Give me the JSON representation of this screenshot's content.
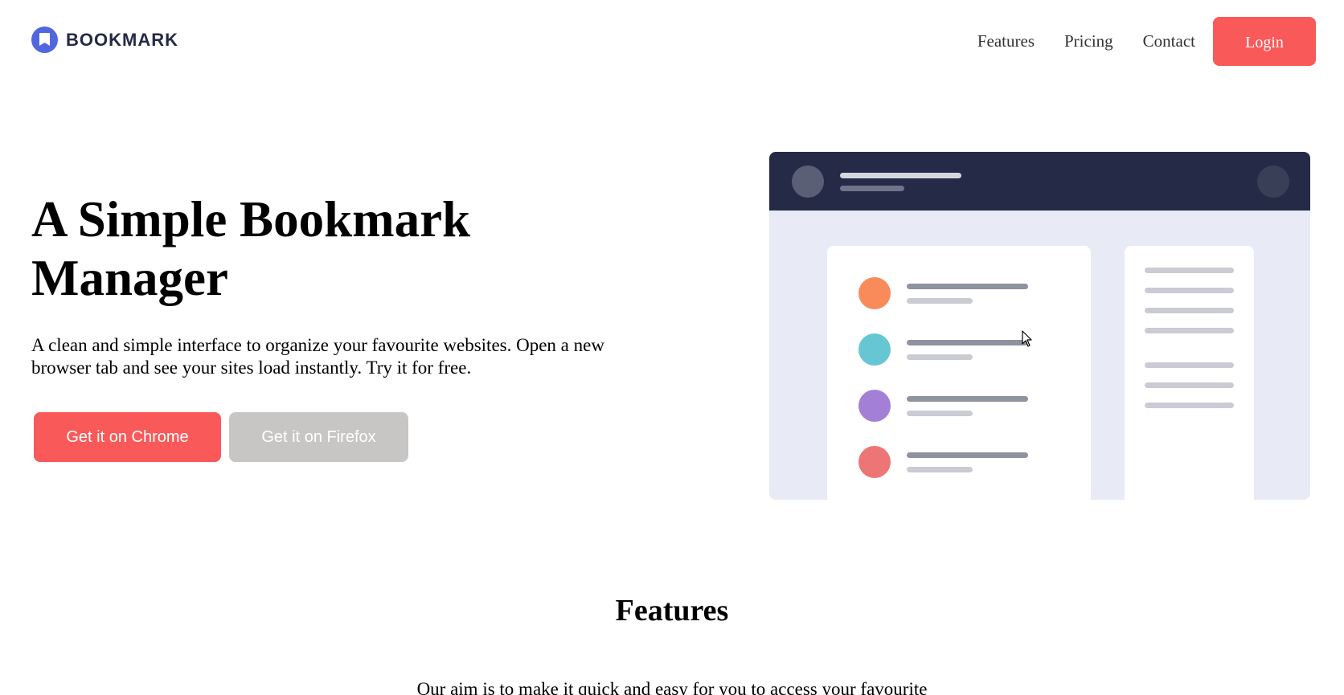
{
  "brand": {
    "name": "BOOKMARK",
    "icon": "bookmark-icon",
    "color": "#5267DF"
  },
  "nav": {
    "links": [
      "Features",
      "Pricing",
      "Contact"
    ],
    "login_label": "Login",
    "login_color": "#FA5959"
  },
  "hero": {
    "title": "A Simple Bookmark Manager",
    "description": "A clean and simple interface to organize your favourite websites. Open a new browser tab and see your sites load instantly. Try it for free.",
    "chrome_button": "Get it on Chrome",
    "firefox_button": "Get it on Firefox"
  },
  "illustration": {
    "header_color": "#252B46",
    "background_color": "#E8EAF6",
    "list_dot_colors": [
      "#F98B5A",
      "#67C6D4",
      "#A47FD6",
      "#EE7576"
    ]
  },
  "features": {
    "title": "Features",
    "description": "Our aim is to make it quick and easy for you to access your favourite"
  }
}
